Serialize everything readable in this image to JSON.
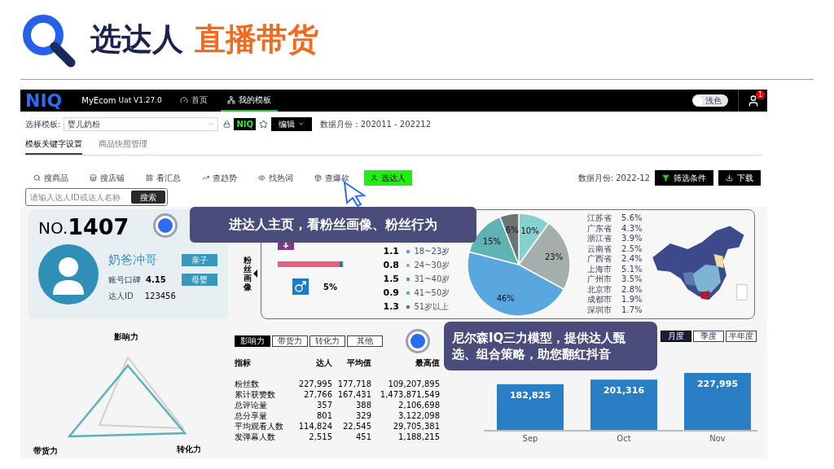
{
  "slide": {
    "title_dark": "选达人",
    "title_accent": "直播带货"
  },
  "topbar": {
    "logo": "NIQ",
    "app": "MyEcom",
    "version": "Uat V1.27.0",
    "nav": [
      {
        "label": "首页",
        "kind": "gauge",
        "selected": false
      },
      {
        "label": "我的模板",
        "kind": "sitemap",
        "selected": true
      }
    ],
    "theme_toggle": {
      "label": "浅色",
      "on": false
    },
    "notifications": "1"
  },
  "template_row": {
    "label": "选择模板:",
    "select_value": "婴儿奶粉",
    "badge": "NIQ",
    "edit": "编辑",
    "data_range": "数据月份 : 202011 - 202212"
  },
  "tabs": [
    {
      "label": "模板关键字设置",
      "selected": true
    },
    {
      "label": "商品快照管理",
      "selected": false
    }
  ],
  "tools": [
    {
      "label": "搜商品",
      "kind": "search",
      "selected": false
    },
    {
      "label": "搜店铺",
      "kind": "store",
      "selected": false
    },
    {
      "label": "看汇总",
      "kind": "grid",
      "selected": false
    },
    {
      "label": "查趋势",
      "kind": "trend",
      "selected": false
    },
    {
      "label": "找热词",
      "kind": "eye",
      "selected": false
    },
    {
      "label": "查爆款",
      "kind": "box",
      "selected": false
    },
    {
      "label": "选达人",
      "kind": "person",
      "selected": true
    }
  ],
  "data_month": "数据月份: 2022-12",
  "filter_button": "筛选条件",
  "download_button": "下载",
  "search": {
    "placeholder": "请输入达人ID或达人名称",
    "button": "搜索"
  },
  "profile": {
    "no_prefix": "NO.",
    "no": "1407",
    "selected": true,
    "name": "奶爸冲哥",
    "tags": [
      "亲子",
      "母婴"
    ],
    "fields": [
      {
        "label": "账号口碑",
        "value": "4.15"
      },
      {
        "label": "达人ID",
        "value": "123456"
      }
    ]
  },
  "fan_portrait": {
    "label": "粉丝画像",
    "gender_bar": {
      "level": 0.95
    },
    "male_share": "5%",
    "ages": [
      {
        "tgi": "1.1",
        "label": "18~23岁",
        "color": "#5aa7e0"
      },
      {
        "tgi": "0.8",
        "label": "24~30岁",
        "color": "#a5adad"
      },
      {
        "tgi": "1.5",
        "label": "31~40岁",
        "color": "#4a9ad8"
      },
      {
        "tgi": "0.9",
        "label": "41~50岁",
        "color": "#5fb3b3"
      },
      {
        "tgi": "1.3",
        "label": "51岁以上",
        "color": "#6b7474"
      }
    ],
    "chart_data": {
      "type": "pie",
      "values": [
        10,
        23,
        46,
        15,
        6
      ],
      "colors": [
        "#86d0d0",
        "#a5adad",
        "#5aa7e0",
        "#5fb3b3",
        "#6b7474"
      ],
      "value_labels": [
        "10%",
        "23%",
        "46%",
        "15%",
        "6%"
      ]
    }
  },
  "regions": [
    {
      "name": "江苏省",
      "share": "5.6%"
    },
    {
      "name": "广东省",
      "share": "4.3%"
    },
    {
      "name": "浙江省",
      "share": "3.9%"
    },
    {
      "name": "云南省",
      "share": "2.5%"
    },
    {
      "name": "广西省",
      "share": "2.4%"
    },
    {
      "name": "上海市",
      "share": "5.1%"
    },
    {
      "name": "广州市",
      "share": "3.5%"
    },
    {
      "name": "北京市",
      "share": "2.8%"
    },
    {
      "name": "成都市",
      "share": "1.9%"
    },
    {
      "name": "深圳市",
      "share": "1.7%"
    }
  ],
  "radar": {
    "top": "影响力",
    "left": "带货力",
    "right": "转化力"
  },
  "metric_tabs": [
    {
      "label": "影响力",
      "selected": true
    },
    {
      "label": "带货力",
      "selected": false
    },
    {
      "label": "转化力",
      "selected": false
    },
    {
      "label": "其他",
      "selected": false
    }
  ],
  "metric_radio": {
    "selected": true
  },
  "table": {
    "columns": [
      "指标",
      "达人",
      "平均值",
      "最高值"
    ],
    "rows": [
      [
        "粉丝数",
        "227,995",
        "177,718",
        "109,207,895"
      ],
      [
        "累计获赞数",
        "27,766",
        "167,431",
        "1,473,871,549"
      ],
      [
        "总评论量",
        "357",
        "388",
        "2,106,698"
      ],
      [
        "总分享量",
        "801",
        "329",
        "3,122,098"
      ],
      [
        "平均观看人数",
        "114,824",
        "22,545",
        "29,705,381"
      ],
      [
        "发弹幕人数",
        "2,515",
        "451",
        "1,188,215"
      ]
    ]
  },
  "period_tabs": [
    {
      "label": "月度",
      "selected": true
    },
    {
      "label": "季度",
      "selected": false
    },
    {
      "label": "半年度",
      "selected": false
    }
  ],
  "monthly_chart": {
    "chart_data": {
      "type": "bar",
      "categories": [
        "Sep",
        "Oct",
        "Nov"
      ],
      "values": [
        182825,
        201316,
        227995
      ],
      "value_labels": [
        "182,825",
        "201,316",
        "227,995"
      ]
    }
  },
  "callouts": [
    "进达人主页，看粉丝画像、粉丝行为",
    "尼尔森IQ三力模型，提供达人甄选、组合策略，助您翻红抖音"
  ]
}
